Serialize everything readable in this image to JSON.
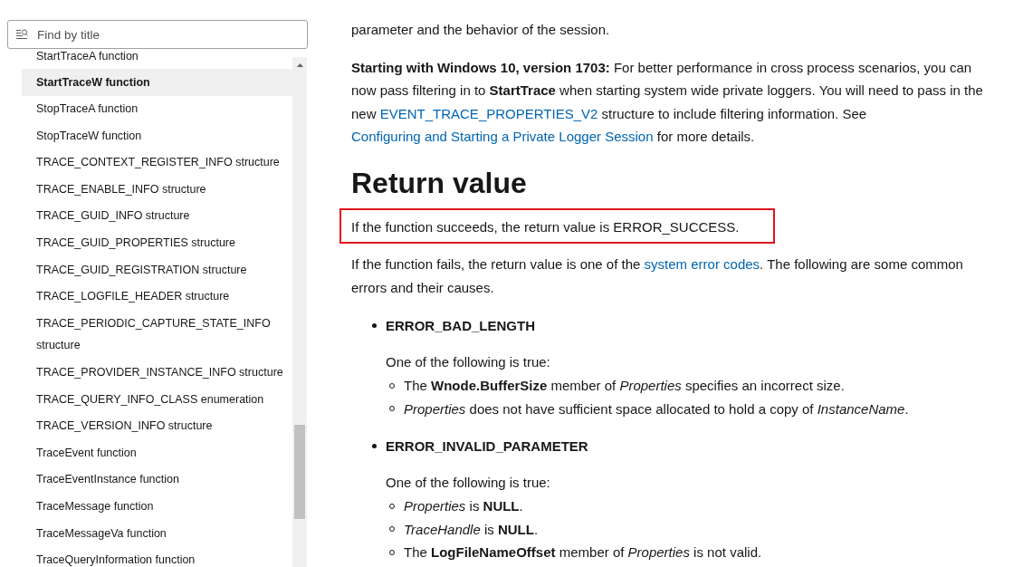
{
  "sidebar": {
    "search": {
      "placeholder": "Find by title"
    },
    "items": [
      {
        "label": "StartTraceA function",
        "selected": false
      },
      {
        "label": "StartTraceW function",
        "selected": true
      },
      {
        "label": "StopTraceA function",
        "selected": false
      },
      {
        "label": "StopTraceW function",
        "selected": false
      },
      {
        "label": "TRACE_CONTEXT_REGISTER_INFO structure",
        "selected": false
      },
      {
        "label": "TRACE_ENABLE_INFO structure",
        "selected": false
      },
      {
        "label": "TRACE_GUID_INFO structure",
        "selected": false
      },
      {
        "label": "TRACE_GUID_PROPERTIES structure",
        "selected": false
      },
      {
        "label": "TRACE_GUID_REGISTRATION structure",
        "selected": false
      },
      {
        "label": "TRACE_LOGFILE_HEADER structure",
        "selected": false
      },
      {
        "label": "TRACE_PERIODIC_CAPTURE_STATE_INFO structure",
        "selected": false
      },
      {
        "label": "TRACE_PROVIDER_INSTANCE_INFO structure",
        "selected": false
      },
      {
        "label": "TRACE_QUERY_INFO_CLASS enumeration",
        "selected": false
      },
      {
        "label": "TRACE_VERSION_INFO structure",
        "selected": false
      },
      {
        "label": "TraceEvent function",
        "selected": false
      },
      {
        "label": "TraceEventInstance function",
        "selected": false
      },
      {
        "label": "TraceMessage function",
        "selected": false
      },
      {
        "label": "TraceMessageVa function",
        "selected": false
      },
      {
        "label": "TraceQueryInformation function",
        "selected": false
      }
    ]
  },
  "article": {
    "blocks": [
      {
        "kind": "paragraph",
        "highlighted": false,
        "runs": [
          {
            "kind": "text",
            "text": "parameter and the behavior of the session."
          }
        ]
      },
      {
        "kind": "paragraph",
        "highlighted": false,
        "runs": [
          {
            "kind": "text",
            "text": "**Starting with Windows 10, version 1703:** For better performance in cross process scenarios, you can now pass filtering in to **StartTrace** when starting system wide private loggers. You will need to pass in the new "
          },
          {
            "kind": "link",
            "text": "EVENT_TRACE_PROPERTIES_V2"
          },
          {
            "kind": "text",
            "text": " structure to include filtering information. See "
          },
          {
            "kind": "link",
            "text": "Configuring and Starting a Private Logger Session"
          },
          {
            "kind": "text",
            "text": " for more details."
          }
        ]
      },
      {
        "kind": "heading",
        "text": "Return value"
      },
      {
        "kind": "paragraph",
        "highlighted": true,
        "runs": [
          {
            "kind": "text",
            "text": "If the function succeeds, the return value is ERROR_SUCCESS."
          }
        ]
      },
      {
        "kind": "paragraph",
        "highlighted": false,
        "runs": [
          {
            "kind": "text",
            "text": "If the function fails, the return value is one of the "
          },
          {
            "kind": "link",
            "text": "system error codes"
          },
          {
            "kind": "text",
            "text": ". The following are some common errors and their causes."
          }
        ]
      },
      {
        "kind": "error_list",
        "items": [
          {
            "code": "ERROR_BAD_LENGTH",
            "intro": "One of the following is true:",
            "conditions": [
              "The **Wnode.BufferSize** member of *Properties* specifies an incorrect size.",
              "*Properties* does not have sufficient space allocated to hold a copy of *InstanceName*."
            ]
          },
          {
            "code": "ERROR_INVALID_PARAMETER",
            "intro": "One of the following is true:",
            "conditions": [
              "*Properties* is **NULL**.",
              "*TraceHandle* is **NULL**.",
              "The **LogFileNameOffset** member of *Properties* is not valid."
            ]
          }
        ]
      }
    ]
  }
}
